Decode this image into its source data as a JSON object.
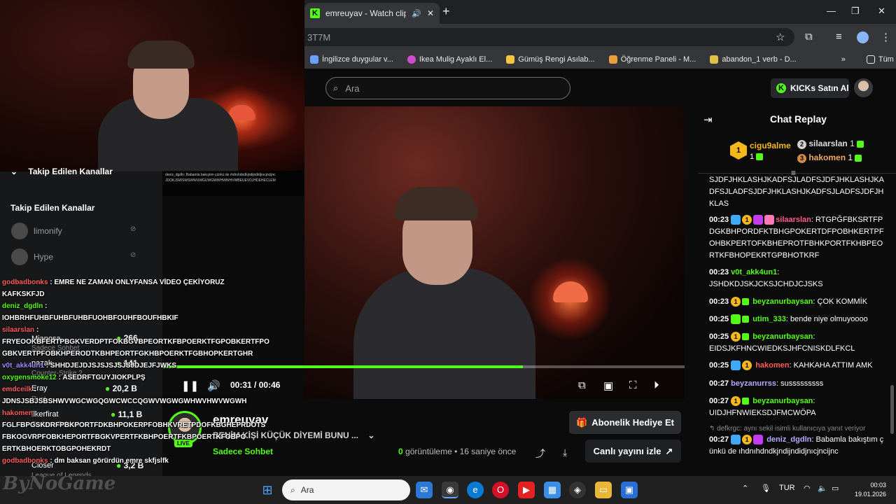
{
  "browser": {
    "tab_title": "emreuyav - Watch clips on K",
    "url_fragment": "3T7M",
    "bookmarks": [
      {
        "label": "İngilizce duygular v...",
        "color": "#6aa1ff"
      },
      {
        "label": "Ikea Mulig Ayaklı El...",
        "color": "#d04dd0"
      },
      {
        "label": "Gümüş Rengi Asılab...",
        "color": "#f5c542"
      },
      {
        "label": "Öğrenme Paneli - M...",
        "color": "#e8a13a"
      },
      {
        "label": "abandon_1 verb - D...",
        "color": "#e0c04a"
      }
    ],
    "bookmarks_more": "»",
    "bookmarks_folder": "Tüm Yer İşaretleri"
  },
  "kick": {
    "search_placeholder": "Ara",
    "buy_kicks": "KICKs Satın Al"
  },
  "sidebar": {
    "top_heading": "Takip Edilen Kanallar",
    "heading": "Takip Edilen Kanallar",
    "channels": [
      {
        "name": "limonify",
        "viewers": ""
      },
      {
        "name": "Hype",
        "viewers": ""
      },
      {
        "name": "Mianosa",
        "viewers": "266",
        "sub": "Sadece Sohbet"
      },
      {
        "name": "pazak",
        "viewers": "141",
        "sub": "Counter-Strike 2"
      },
      {
        "name": "Eray",
        "viewers": "20,2 B",
        "sub": "Rust"
      },
      {
        "name": "ilkerfirat",
        "viewers": "11,1 B",
        "sub": "Sadece Sohbet"
      },
      {
        "name": "Closer",
        "viewers": "3,2 B",
        "sub": "League of Legends"
      }
    ]
  },
  "player": {
    "time_current": "00:31",
    "time_total": "00:46",
    "progress": 0.69
  },
  "clip": {
    "channel": "emreuyav",
    "live_badge": "LIVE",
    "title": "BENİM KİŞİ KÜÇÜK DİYEMİ BUNU ...",
    "category": "Sadece Sohbet",
    "views_count": "0",
    "views_label": "görüntüleme",
    "age": "16 saniye önce",
    "gift_sub": "Abonelik Hediye Et",
    "watch_live": "Canlı yayını izle"
  },
  "overlay_chat": [
    {
      "user": "godbadbonks",
      "text": ": EMRE NE ZAMAN ONLYFANSA VİDEO ÇEKİYORUZ",
      "cls": "ur"
    },
    {
      "user": "",
      "text": "KAFKSKFJD",
      "cls": ""
    },
    {
      "user": "deniz_dgdln",
      "text": ":",
      "cls": "u"
    },
    {
      "user": "",
      "text": "IOHBRHFUHBFUHBFUHBFUOHBFOUHFBOUFHBKIF",
      "cls": ""
    },
    {
      "user": "silaarslan",
      "text": ":",
      "cls": "ur"
    },
    {
      "user": "",
      "text": "FRYEOOKBFERTPBGKVERDPTFOKBGVBPEORTKFBPOERKTFGPOBKERTFPO",
      "cls": ""
    },
    {
      "user": "",
      "text": "GBKVERTPFOBKHPERODTKBHPEORTFGKHBPOERKTFGBHOPKERTGHR",
      "cls": ""
    },
    {
      "user": "v0t_akk4un1",
      "text": ": SHHDJEJDJSJSJSJSJSJDJEJFJWKS",
      "cls": "ub"
    },
    {
      "user": "oxygensmoke12",
      "text": ": ASEDRFTGUYJIOKPLPŞ",
      "cls": "u"
    },
    {
      "user": "emdceilk",
      "text": ":",
      "cls": "ur"
    },
    {
      "user": "",
      "text": "JDNSJSBJSBSHWVWGCWGQGWCWCCQGWVWGWGWHWVHWVWGWH",
      "cls": ""
    },
    {
      "user": "hakomen",
      "text": ":",
      "cls": "ur"
    },
    {
      "user": "",
      "text": "FGLFBPGSKDRFPBKPORTFDKBHPOKERPFOBHKVRETPDOFKBGHEPRDOTS",
      "cls": ""
    },
    {
      "user": "",
      "text": "FBKOGVRPFOBKHEPORTFBGKVPERTFKBHPOERTFKBPOERTKFOBPO",
      "cls": ""
    },
    {
      "user": "",
      "text": "ERTKBHOERKTOBGPOHEKRDT",
      "cls": ""
    },
    {
      "user": "godbadbonks",
      "text": ": dm baksan görürdün emre skfjslfk",
      "cls": "ur"
    }
  ],
  "chat": {
    "heading": "Chat Replay",
    "leaders": [
      {
        "rank": "1",
        "name": "cigu9alme",
        "count": "1"
      },
      {
        "rank": "2",
        "name": "silaarslan",
        "count": "1"
      },
      {
        "rank": "3",
        "name": "hakomen",
        "count": "1"
      }
    ],
    "messages": [
      {
        "time": "",
        "user": "",
        "user_color": "#ffffff",
        "text": "SJDFJHKLASHJKADFSJLADFSJDFJHKLASHJKADFSJLADFSJDFJHKLASHJKADFSJLADFSJDFJHKLAS"
      },
      {
        "time": "00:23",
        "user": "silaarslan",
        "user_color": "#ff5c8a",
        "text": "RTGPĞFBKSRTFPDGKBHPORDFKTBHGPOKERTDFPOBHKERTPFOHBKPERTOFKBHEPROTFBHKPORTFKHBPEORTKFBHOPEKRTGPBHOTKRF"
      },
      {
        "time": "00:23",
        "user": "v0t_akk4un1",
        "user_color": "#53fc18",
        "text": "JSHDKDJSKJCKSJCHDJCJSKS"
      },
      {
        "time": "00:23",
        "user": "beyzanurbaysan",
        "user_color": "#53fc18",
        "text": "ÇOK KOMMİK"
      },
      {
        "time": "00:25",
        "user": "utim_333",
        "user_color": "#53fc18",
        "text": "bende niye olmuyoooo"
      },
      {
        "time": "00:25",
        "user": "beyzanurbaysan",
        "user_color": "#53fc18",
        "text": "EIDSJKFHNCWIEDKSJHFCNISKDLFKCL"
      },
      {
        "time": "00:25",
        "user": "hakomen",
        "user_color": "#ff5c5c",
        "text": "KAHKAHA ATTIM AMK"
      },
      {
        "time": "00:27",
        "user": "beyzanurrss",
        "user_color": "#9f8cff",
        "text": "susssssssss"
      },
      {
        "time": "00:27",
        "user": "beyzanurbaysan",
        "user_color": "#53fc18",
        "text": "UIDJHFNWIEKSDJFMCWÖPA"
      }
    ],
    "reply_hint": "defkrgc: aynı sekil isimli kullanıcıya yanıt veriyor",
    "last": {
      "time": "00:27",
      "user": "deniz_dgdln",
      "user_color": "#b9a7ff",
      "text": "Babamla bakıştım çünkü de ıhdnıhdndkjndijndidjnıcjncijnc"
    }
  },
  "taskbar": {
    "search_placeholder": "Ara",
    "lang": "TUR",
    "time": "00:03",
    "date": "19.01.2026"
  },
  "watermark": "ByNoGame",
  "webcam_chat_text": "deniz_dgdln: Babamla bakıştım çünkü de ıhdnıhdndkjndijndidjnıcjncijnc JDOKJSWSWSWWUWGUWGWWHWWHVWBEUEVDJHDEHECLEM",
  "colors": {
    "brand": "#53fc18"
  }
}
